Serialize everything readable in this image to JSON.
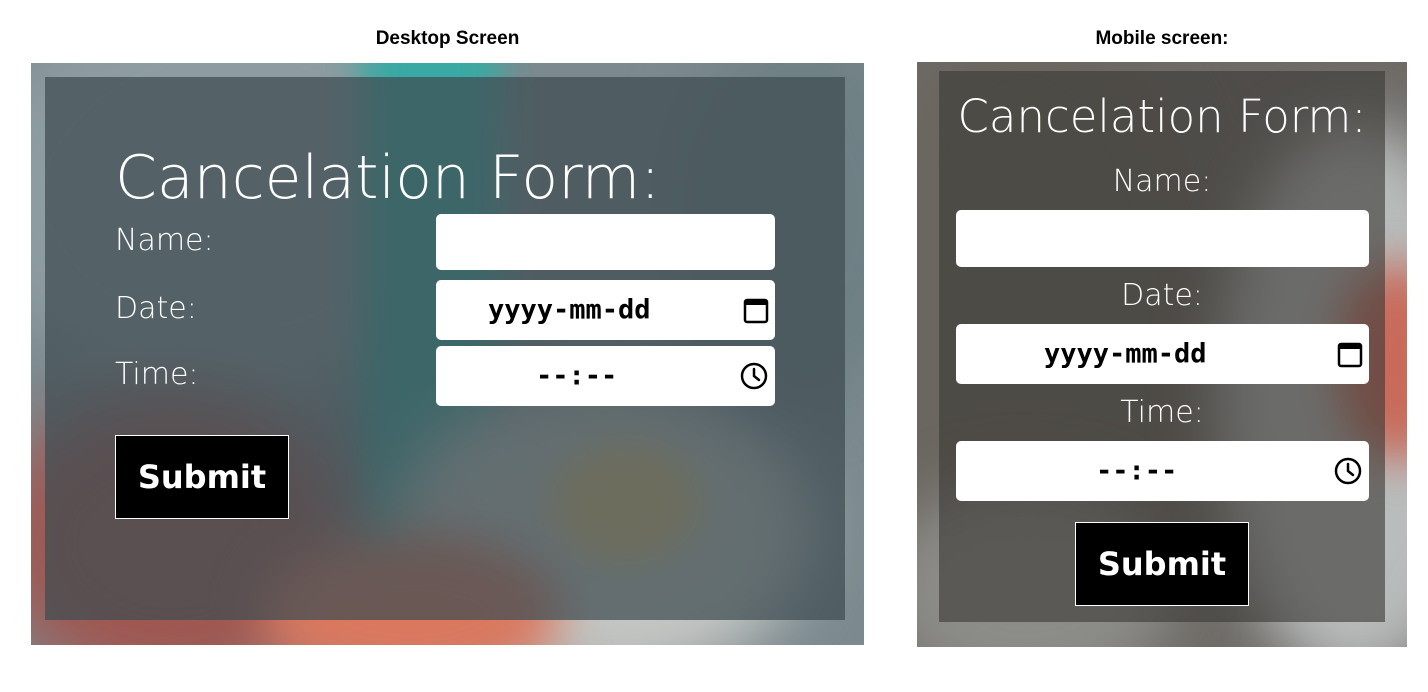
{
  "captions": {
    "desktop": "Desktop Screen",
    "mobile": "Mobile screen:"
  },
  "form": {
    "title": "Cancelation Form:",
    "name_label": "Name:",
    "date_label": "Date:",
    "time_label": "Time:",
    "name_value": "",
    "date_placeholder": "yyyy-mm-dd",
    "time_placeholder": "--:--",
    "submit_label": "Submit"
  },
  "icons": {
    "date": "calendar-icon",
    "time": "clock-icon"
  },
  "colors": {
    "overlay": "#3f4c52",
    "button": "#000000",
    "field": "#ffffff",
    "text": "#ffffff"
  }
}
